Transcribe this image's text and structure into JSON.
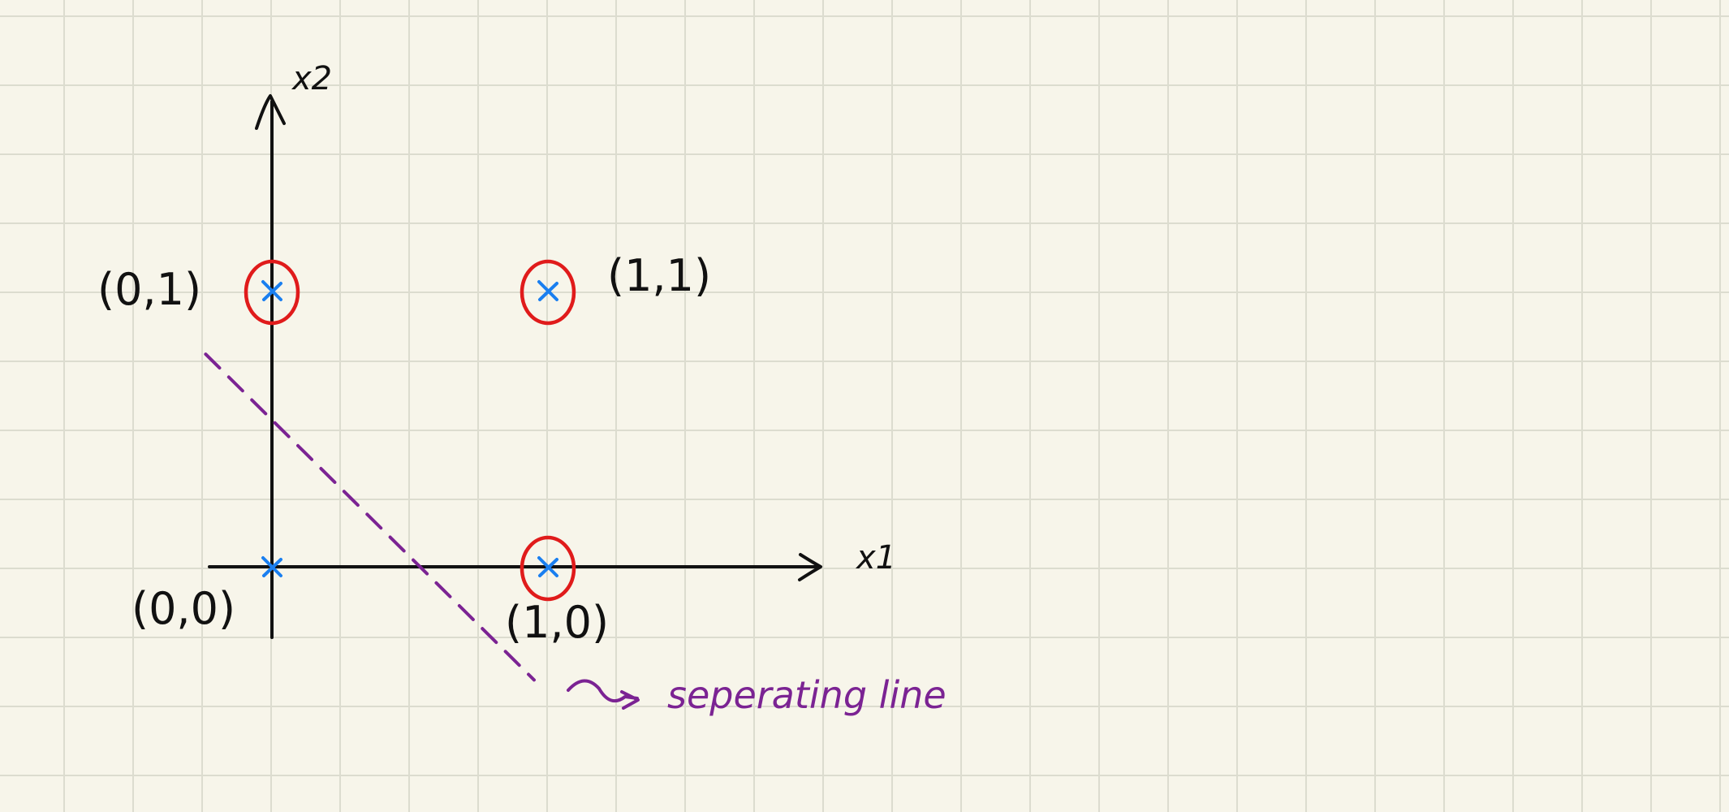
{
  "colors": {
    "paper": "#f7f5ea",
    "grid": "#dcdccf",
    "ink": "#111111",
    "point": "#1a7ff0",
    "circle": "#e01b1b",
    "line": "#7b2393"
  },
  "axes": {
    "x_label": "x1",
    "y_label": "x2"
  },
  "points": [
    {
      "label": "(0,0)",
      "x": 0,
      "y": 0,
      "circled": false
    },
    {
      "label": "(1,0)",
      "x": 1,
      "y": 0,
      "circled": true
    },
    {
      "label": "(0,1)",
      "x": 0,
      "y": 1,
      "circled": true
    },
    {
      "label": "(1,1)",
      "x": 1,
      "y": 1,
      "circled": true
    }
  ],
  "separating_line": {
    "label": "seperating line",
    "style": "dashed",
    "through": [
      [
        -0.24,
        0.77
      ],
      [
        0.95,
        -0.41
      ]
    ]
  }
}
